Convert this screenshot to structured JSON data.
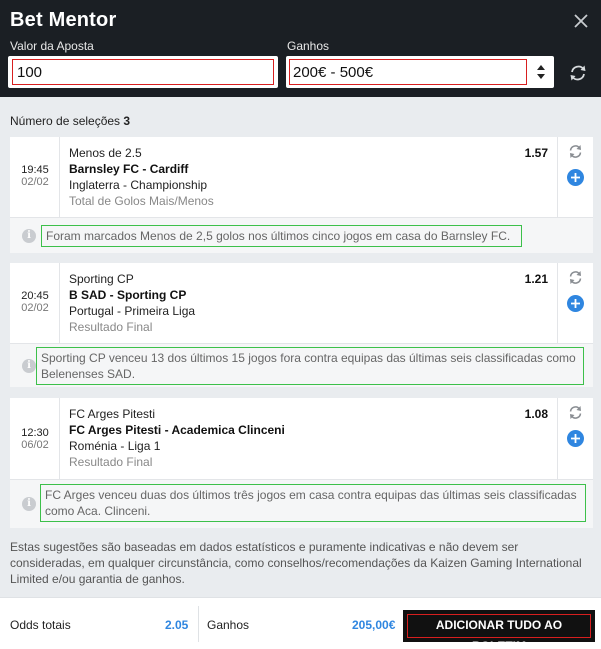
{
  "header": {
    "title": "Bet Mentor",
    "stake_label": "Valor da Aposta",
    "stake_value": "100",
    "gains_label": "Ganhos",
    "gains_value": "200€ - 500€"
  },
  "selections": {
    "count_label": "Número de seleções",
    "count": "3",
    "items": [
      {
        "time": "19:45",
        "date": "02/02",
        "selection": "Menos de 2.5",
        "match": "Barnsley FC - Cardiff",
        "league": "Inglaterra - Championship",
        "market": "Total de Golos Mais/Menos",
        "odd": "1.57",
        "tip": "Foram marcados Menos de 2,5 golos nos últimos cinco jogos em casa do Barnsley FC."
      },
      {
        "time": "20:45",
        "date": "02/02",
        "selection": "Sporting CP",
        "match": "B SAD - Sporting CP",
        "league": "Portugal - Primeira Liga",
        "market": "Resultado Final",
        "odd": "1.21",
        "tip": "Sporting CP venceu 13 dos últimos 15 jogos fora contra equipas das últimas seis classificadas como Belenenses SAD."
      },
      {
        "time": "12:30",
        "date": "06/02",
        "selection": "FC Arges Pitesti",
        "match": "FC Arges Pitesti - Academica Clinceni",
        "league": "Roménia - Liga 1",
        "market": "Resultado Final",
        "odd": "1.08",
        "tip": "FC Arges venceu duas dos últimos três jogos em casa contra equipas das últimas seis classificadas como Aca. Clinceni."
      }
    ]
  },
  "disclaimer": "Estas sugestões são baseadas em dados estatísticos e puramente indicativas e não devem ser consideradas, em qualquer circunstância, como conselhos/recomendações da Kaizen Gaming International Limited e/ou garantia de ganhos.",
  "footer": {
    "odds_label": "Odds totais",
    "odds_value": "2.05",
    "gains_label": "Ganhos",
    "gains_value": "205,00€",
    "add_all_label": "ADICIONAR TUDO AO BOLETIM"
  },
  "colors": {
    "header_bg": "#1b1f24",
    "accent_blue": "#2f86e0",
    "highlight_red": "#d81f1f",
    "highlight_green": "#3cc04a"
  },
  "icons": [
    "close-icon",
    "refresh-icon",
    "select-arrows-icon",
    "plus-icon",
    "info-icon"
  ]
}
